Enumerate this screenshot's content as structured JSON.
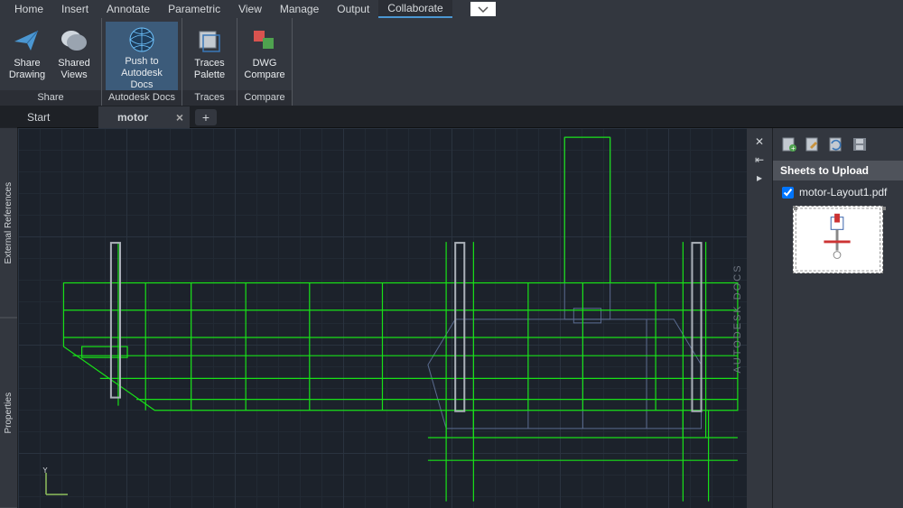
{
  "menubar": {
    "items": [
      "Home",
      "Insert",
      "Annotate",
      "Parametric",
      "View",
      "Manage",
      "Output",
      "Collaborate"
    ],
    "active_index": 7
  },
  "ribbon": {
    "panels": [
      {
        "title": "Share",
        "buttons": [
          {
            "label": "Share Drawing",
            "name": "share-drawing-button",
            "icon": "send-icon"
          },
          {
            "label": "Shared Views",
            "name": "shared-views-button",
            "icon": "cubes-icon"
          }
        ]
      },
      {
        "title": "Autodesk Docs",
        "buttons": [
          {
            "label": "Push to Autodesk Docs",
            "name": "push-to-docs-button",
            "icon": "globe-icon",
            "highlight": true
          }
        ]
      },
      {
        "title": "Traces",
        "buttons": [
          {
            "label": "Traces Palette",
            "name": "traces-palette-button",
            "icon": "palette-icon"
          }
        ]
      },
      {
        "title": "Compare",
        "buttons": [
          {
            "label": "DWG Compare",
            "name": "dwg-compare-button",
            "icon": "compare-icon"
          }
        ]
      }
    ]
  },
  "tabs": {
    "items": [
      {
        "label": "Start",
        "active": false
      },
      {
        "label": "motor",
        "active": true
      }
    ]
  },
  "canvas": {
    "axis_label": "Y",
    "watermark": "AUTODESK DOCS"
  },
  "leftpanel": {
    "tabs": [
      "External References",
      "Properties"
    ]
  },
  "rightpanel": {
    "title": "Sheets to Upload",
    "sheets": [
      {
        "name": "motor-Layout1.pdf",
        "checked": true
      }
    ]
  },
  "plus_sign": "+"
}
